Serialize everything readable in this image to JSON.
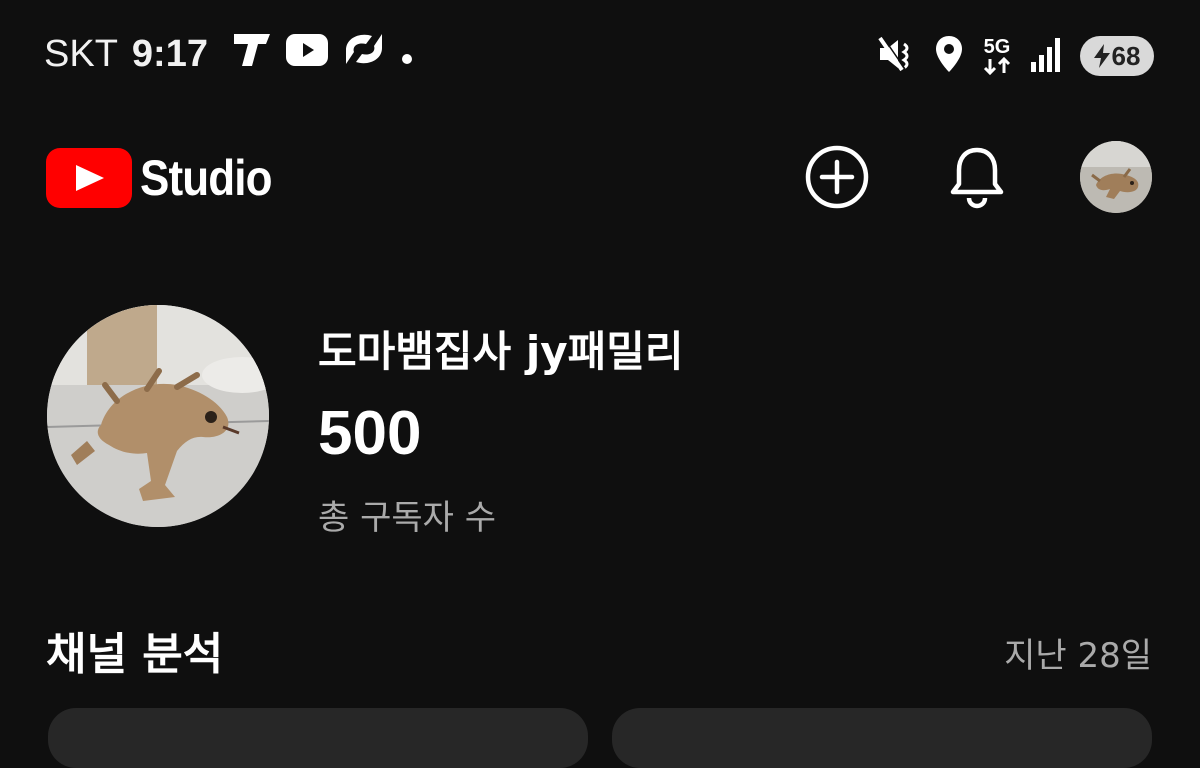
{
  "status_bar": {
    "carrier": "SKT",
    "time": "9:17",
    "app_icons": [
      "t-map-icon",
      "youtube-icon",
      "swirl-app-icon",
      "dot-icon"
    ],
    "system_icons": [
      "vibrate-mute-icon",
      "location-icon",
      "5g-icon",
      "signal-icon"
    ],
    "network": "5G",
    "battery": "68"
  },
  "header": {
    "app_name": "Studio",
    "actions": [
      "create-add-icon",
      "notifications-bell-icon",
      "account-avatar"
    ]
  },
  "channel": {
    "name": "도마뱀집사 jy패밀리",
    "subscriber_count": "500",
    "subscriber_label": "총 구독자 수"
  },
  "analytics": {
    "title": "채널 분석",
    "period": "지난 28일"
  },
  "colors": {
    "background": "#0f0f0f",
    "youtube_red": "#ff0000",
    "secondary_text": "#aaaaaa",
    "card": "#272727"
  }
}
